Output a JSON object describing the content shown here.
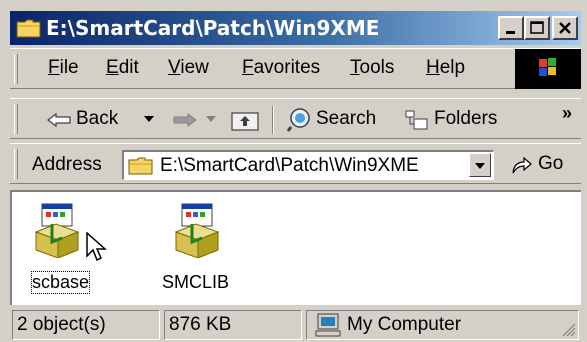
{
  "window": {
    "title": "E:\\SmartCard\\Patch\\Win9XME",
    "title_icon": "folder-icon",
    "buttons": [
      "minimize-icon",
      "maximize-icon",
      "close-icon"
    ]
  },
  "menu": {
    "items": [
      "File",
      "Edit",
      "View",
      "Favorites",
      "Tools",
      "Help"
    ]
  },
  "toolbar": {
    "back_label": "Back",
    "search_label": "Search",
    "folders_label": "Folders",
    "overflow": "»"
  },
  "address": {
    "label": "Address",
    "value": "E:\\SmartCard\\Patch\\Win9XME",
    "go_label": "Go"
  },
  "files": [
    {
      "name": "scbase",
      "icon": "setup-program-icon",
      "selected": true
    },
    {
      "name": "SMCLIB",
      "icon": "setup-program-icon",
      "selected": false
    }
  ],
  "status": {
    "objects": "2 object(s)",
    "size": "876 KB",
    "location": "My Computer"
  },
  "colors": {
    "title_start": "#0a246a",
    "title_end": "#a6caf0",
    "chrome": "#d4d0c8"
  }
}
